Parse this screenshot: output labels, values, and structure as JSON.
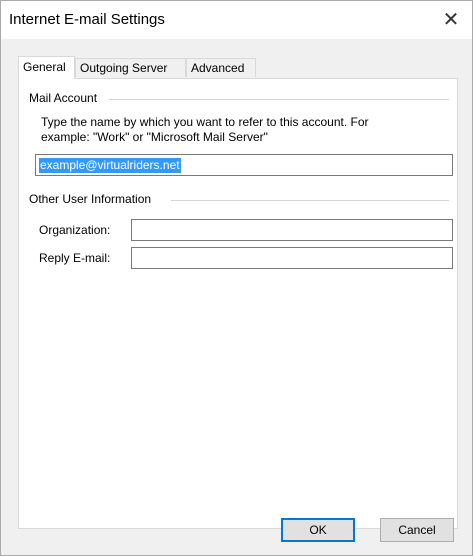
{
  "window": {
    "title": "Internet E-mail Settings",
    "close_glyph": "✕"
  },
  "tabs": [
    {
      "label": "General",
      "active": true
    },
    {
      "label": "Outgoing Server",
      "active": false
    },
    {
      "label": "Advanced",
      "active": false
    }
  ],
  "mail_account": {
    "group_label": "Mail Account",
    "description_line1": "Type the name by which you want to refer to this account. For",
    "description_line2": "example: \"Work\" or \"Microsoft Mail Server\"",
    "account_name_value": "example@virtualriders.net"
  },
  "other_user_info": {
    "group_label": "Other User Information",
    "organization_label": "Organization:",
    "organization_value": "",
    "reply_email_label": "Reply E-mail:",
    "reply_email_value": ""
  },
  "buttons": {
    "ok": "OK",
    "cancel": "Cancel"
  },
  "colors": {
    "selection": "#3399ff",
    "default_button_border": "#0078d7"
  }
}
